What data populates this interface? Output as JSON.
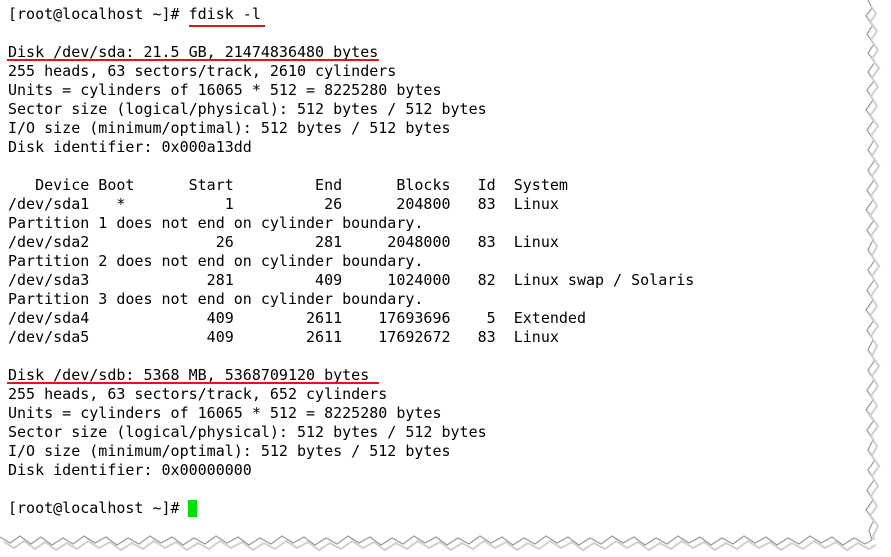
{
  "terminal": {
    "prompt": "[root@localhost ~]# ",
    "command": "fdisk -l",
    "lines": [
      "",
      "Disk /dev/sda: 21.5 GB, 21474836480 bytes",
      "255 heads, 63 sectors/track, 2610 cylinders",
      "Units = cylinders of 16065 * 512 = 8225280 bytes",
      "Sector size (logical/physical): 512 bytes / 512 bytes",
      "I/O size (minimum/optimal): 512 bytes / 512 bytes",
      "Disk identifier: 0x000a13dd",
      "",
      "   Device Boot      Start         End      Blocks   Id  System",
      "/dev/sda1   *           1          26      204800   83  Linux",
      "Partition 1 does not end on cylinder boundary.",
      "/dev/sda2              26         281     2048000   83  Linux",
      "Partition 2 does not end on cylinder boundary.",
      "/dev/sda3             281         409     1024000   82  Linux swap / Solaris",
      "Partition 3 does not end on cylinder boundary.",
      "/dev/sda4             409        2611    17693696    5  Extended",
      "/dev/sda5             409        2611    17692672   83  Linux",
      "",
      "Disk /dev/sdb: 5368 MB, 5368709120 bytes",
      "255 heads, 63 sectors/track, 652 cylinders",
      "Units = cylinders of 16065 * 512 = 8225280 bytes",
      "Sector size (logical/physical): 512 bytes / 512 bytes",
      "I/O size (minimum/optimal): 512 bytes / 512 bytes",
      "Disk identifier: 0x00000000",
      ""
    ],
    "final_prompt": "[root@localhost ~]# "
  },
  "colors": {
    "underline": "#e0151b",
    "cursor": "#00e000"
  }
}
